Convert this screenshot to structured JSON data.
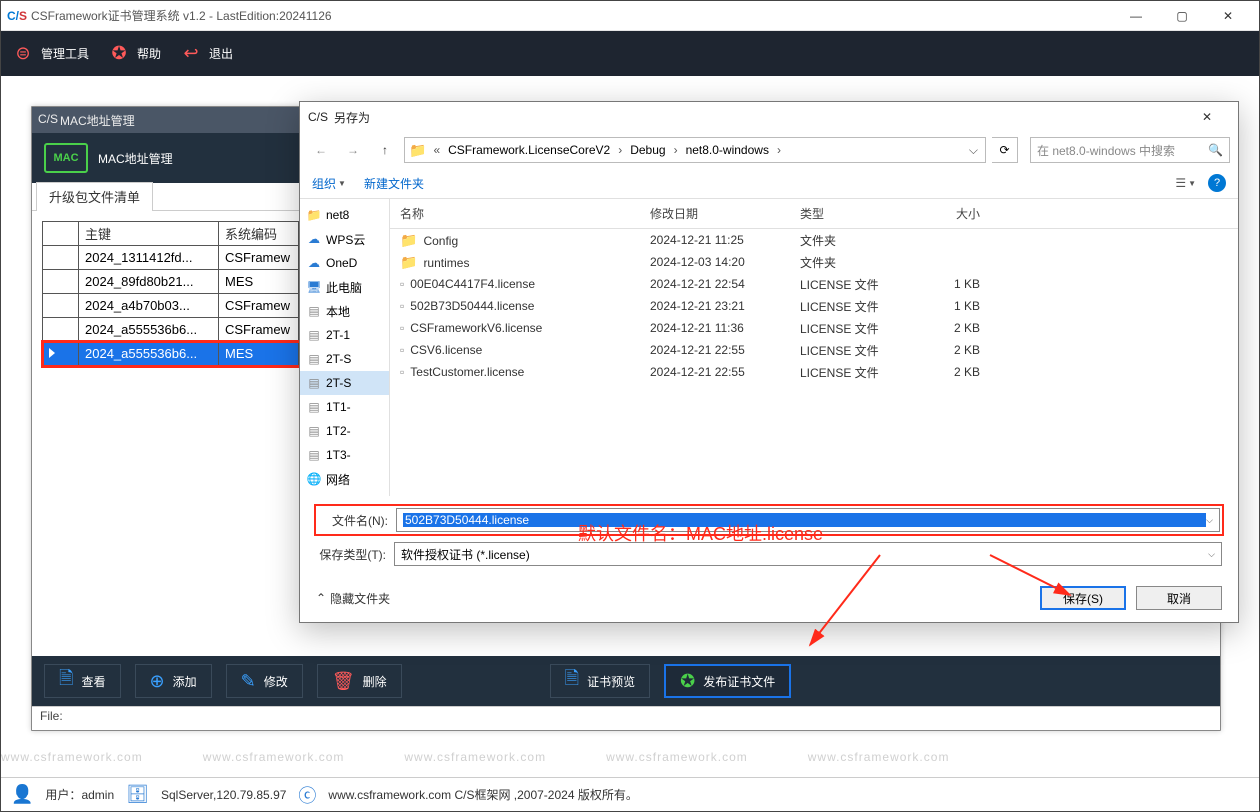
{
  "window": {
    "title": "CSFramework证书管理系统 v1.2 - LastEdition:20241126"
  },
  "ribbon": {
    "tools": "管理工具",
    "help": "帮助",
    "exit": "退出"
  },
  "inner": {
    "title": "MAC地址管理",
    "header": "MAC地址管理",
    "mac_badge": "MAC",
    "tab": "升级包文件清单",
    "status": "File:",
    "columns": {
      "key": "主键",
      "syscode": "系统编码"
    },
    "rows": [
      {
        "key": "2024_1311412fd...",
        "sys": "CSFramew"
      },
      {
        "key": "2024_89fd80b21...",
        "sys": "MES"
      },
      {
        "key": "2024_a4b70b03...",
        "sys": "CSFramew"
      },
      {
        "key": "2024_a555536b6...",
        "sys": "CSFramew"
      },
      {
        "key": "2024_a555536b6...",
        "sys": "MES"
      }
    ],
    "toolbar": {
      "view": "查看",
      "add": "添加",
      "edit": "修改",
      "delete": "删除",
      "preview": "证书预览",
      "publish": "发布证书文件"
    }
  },
  "saveas": {
    "title": "另存为",
    "breadcrumb": [
      "CSFramework.LicenseCoreV2",
      "Debug",
      "net8.0-windows"
    ],
    "search_placeholder": "在 net8.0-windows 中搜索",
    "organize": "组织",
    "new_folder": "新建文件夹",
    "cols": {
      "name": "名称",
      "date": "修改日期",
      "type": "类型",
      "size": "大小"
    },
    "tree": [
      {
        "label": "net8",
        "icon": "folder"
      },
      {
        "label": "WPS云",
        "icon": "cloud"
      },
      {
        "label": "OneD",
        "icon": "cloud"
      },
      {
        "label": "此电脑",
        "icon": "pc"
      },
      {
        "label": "本地",
        "icon": "disk"
      },
      {
        "label": "2T-1",
        "icon": "disk"
      },
      {
        "label": "2T-S",
        "icon": "disk"
      },
      {
        "label": "2T-S",
        "icon": "disk",
        "selected": true
      },
      {
        "label": "1T1-",
        "icon": "disk"
      },
      {
        "label": "1T2-",
        "icon": "disk"
      },
      {
        "label": "1T3-",
        "icon": "disk"
      },
      {
        "label": "网络",
        "icon": "net"
      }
    ],
    "files": [
      {
        "name": "Config",
        "date": "2024-12-21 11:25",
        "type": "文件夹",
        "size": "",
        "folder": true
      },
      {
        "name": "runtimes",
        "date": "2024-12-03 14:20",
        "type": "文件夹",
        "size": "",
        "folder": true
      },
      {
        "name": "00E04C4417F4.license",
        "date": "2024-12-21 22:54",
        "type": "LICENSE 文件",
        "size": "1 KB",
        "folder": false
      },
      {
        "name": "502B73D50444.license",
        "date": "2024-12-21 23:21",
        "type": "LICENSE 文件",
        "size": "1 KB",
        "folder": false
      },
      {
        "name": "CSFrameworkV6.license",
        "date": "2024-12-21 11:36",
        "type": "LICENSE 文件",
        "size": "2 KB",
        "folder": false
      },
      {
        "name": "CSV6.license",
        "date": "2024-12-21 22:55",
        "type": "LICENSE 文件",
        "size": "2 KB",
        "folder": false
      },
      {
        "name": "TestCustomer.license",
        "date": "2024-12-21 22:55",
        "type": "LICENSE 文件",
        "size": "2 KB",
        "folder": false
      }
    ],
    "filename_label": "文件名(N):",
    "filename_value": "502B73D50444.license",
    "type_label": "保存类型(T):",
    "type_value": "软件授权证书 (*.license)",
    "hide_folders": "隐藏文件夹",
    "save": "保存(S)",
    "cancel": "取消"
  },
  "annotation": "默认文件名：MAC地址.license",
  "footer": {
    "user_label": "用户：",
    "user": "admin",
    "db": "SqlServer,120.79.85.97",
    "site": "www.csframework.com C/S框架网 ,2007-2024 版权所有。"
  },
  "watermark": "www.csframework.com"
}
